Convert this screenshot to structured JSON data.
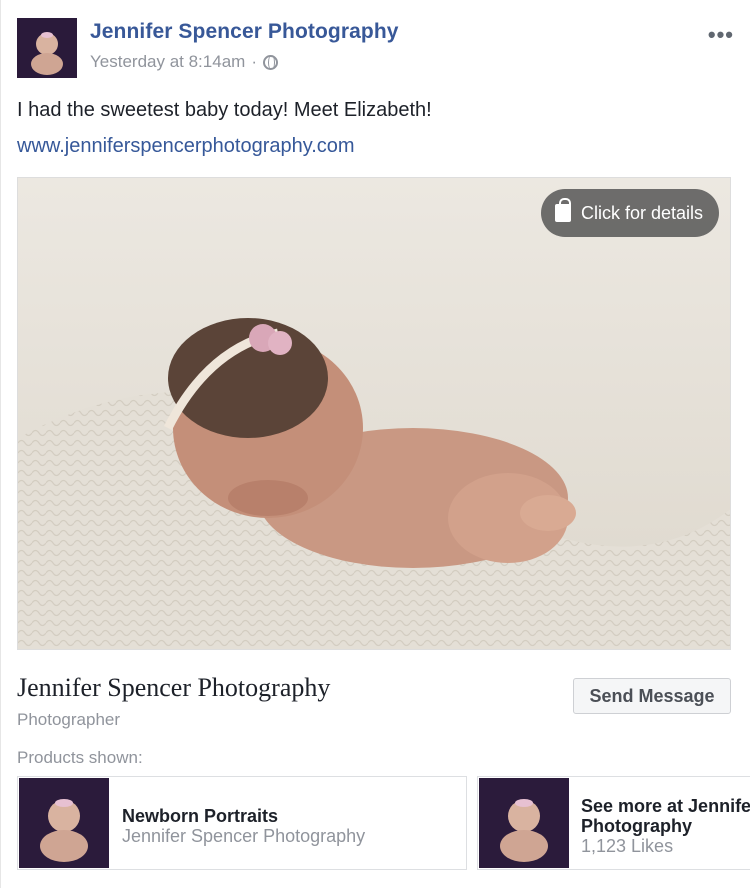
{
  "post": {
    "page_name": "Jennifer Spencer Photography",
    "timestamp": "Yesterday at 8:14am",
    "separator": "·",
    "privacy_icon": "globe-icon",
    "more_label": "•••",
    "message": "I had the sweetest baby today! Meet Elizabeth!",
    "link": "www.jenniferspencerphotography.com"
  },
  "photo": {
    "details_label": "Click for details",
    "details_icon": "shopping-bag-icon"
  },
  "page_info": {
    "name": "Jennifer Spencer Photography",
    "category": "Photographer",
    "send_label": "Send Message"
  },
  "products": {
    "label": "Products shown:",
    "items": [
      {
        "title": "Newborn Portraits",
        "subtitle": "Jennifer Spencer Photography"
      },
      {
        "title_line1": "See more at Jennife",
        "title_line2": "Photography",
        "subtitle": "1,123 Likes"
      }
    ]
  },
  "colors": {
    "link": "#385898",
    "meta": "#90949c",
    "text": "#1d2129"
  }
}
